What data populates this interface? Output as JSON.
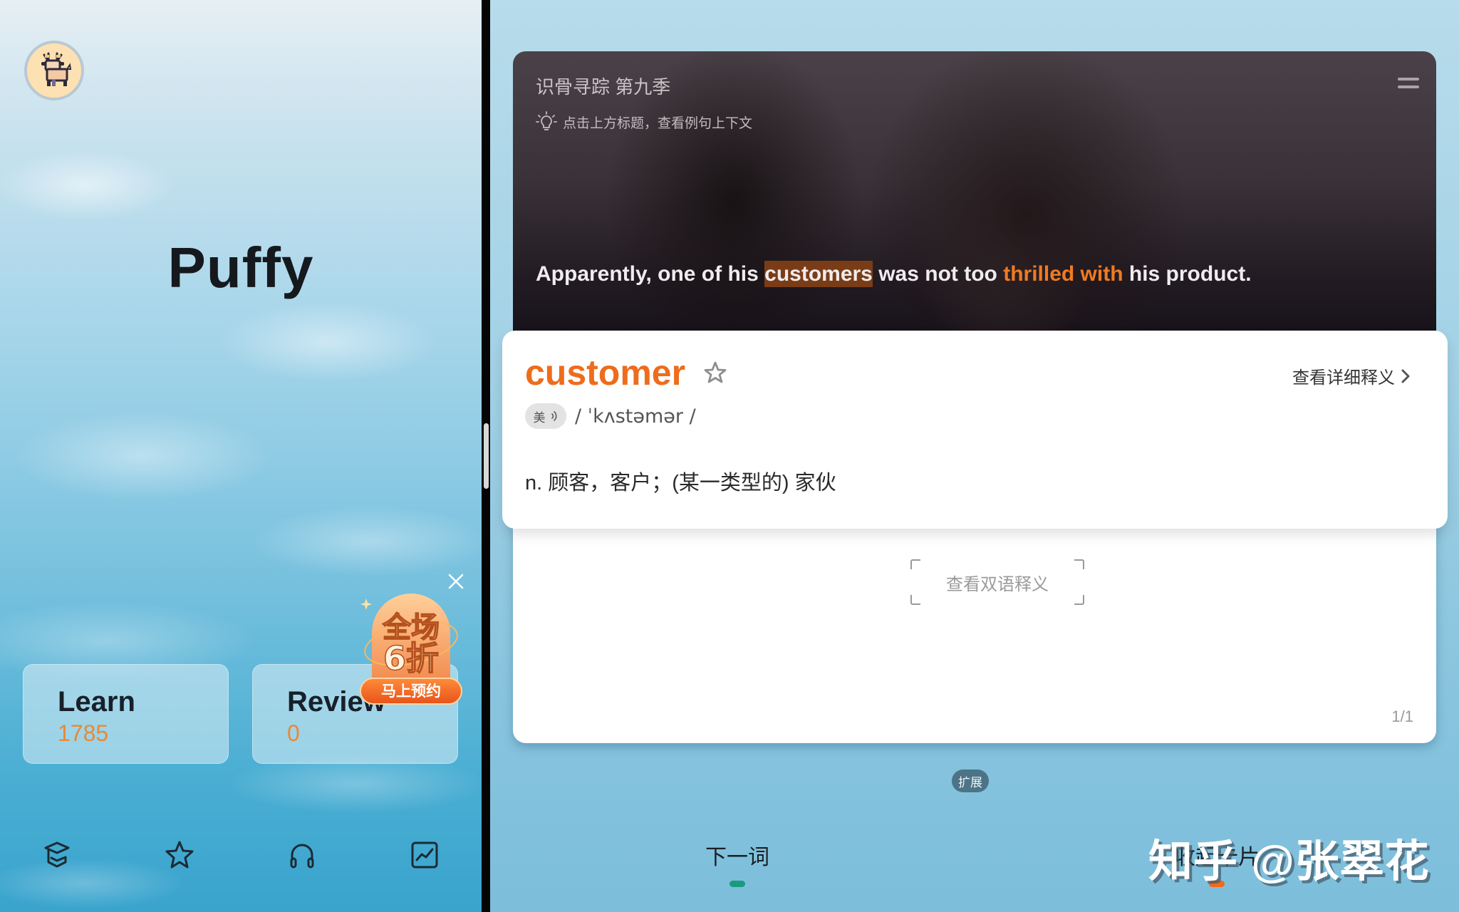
{
  "left": {
    "app_title": "Puffy",
    "stats": [
      {
        "label": "Learn",
        "value": "1785"
      },
      {
        "label": "Review",
        "value": "0"
      }
    ],
    "promo": {
      "line1": "全场",
      "line2": "6折",
      "cta": "马上预约"
    },
    "bottom_nav": [
      {
        "icon": "graduation-cap-icon"
      },
      {
        "icon": "star-icon"
      },
      {
        "icon": "headphones-icon"
      },
      {
        "icon": "chart-icon"
      }
    ]
  },
  "right": {
    "video": {
      "title": "识骨寻踪 第九季",
      "hint": "点击上方标题，查看例句上下文",
      "subtitle": {
        "before": "Apparently, one of his ",
        "highlight": "customers",
        "middle": " was not too ",
        "phrase": "thrilled with",
        "after": " his product."
      }
    },
    "word_card": {
      "headword": "customer",
      "detail_link": "查看详细释义",
      "accent_label": "美",
      "phonetic": "/ ˈkʌstəmər /",
      "definition": "n. 顾客，客户；(某一类型的) 家伙"
    },
    "bilingual_button": "查看双语释义",
    "page_indicator": "1/1",
    "expand_label": "扩展",
    "actions": {
      "next_word": "下一词",
      "collapse_card": "收起卡片"
    },
    "colors": {
      "accent_orange": "#ee6c1c",
      "next_indicator": "#1a9a80",
      "collapse_indicator": "#f06a1a"
    }
  },
  "watermark": "知乎 @张翠花"
}
